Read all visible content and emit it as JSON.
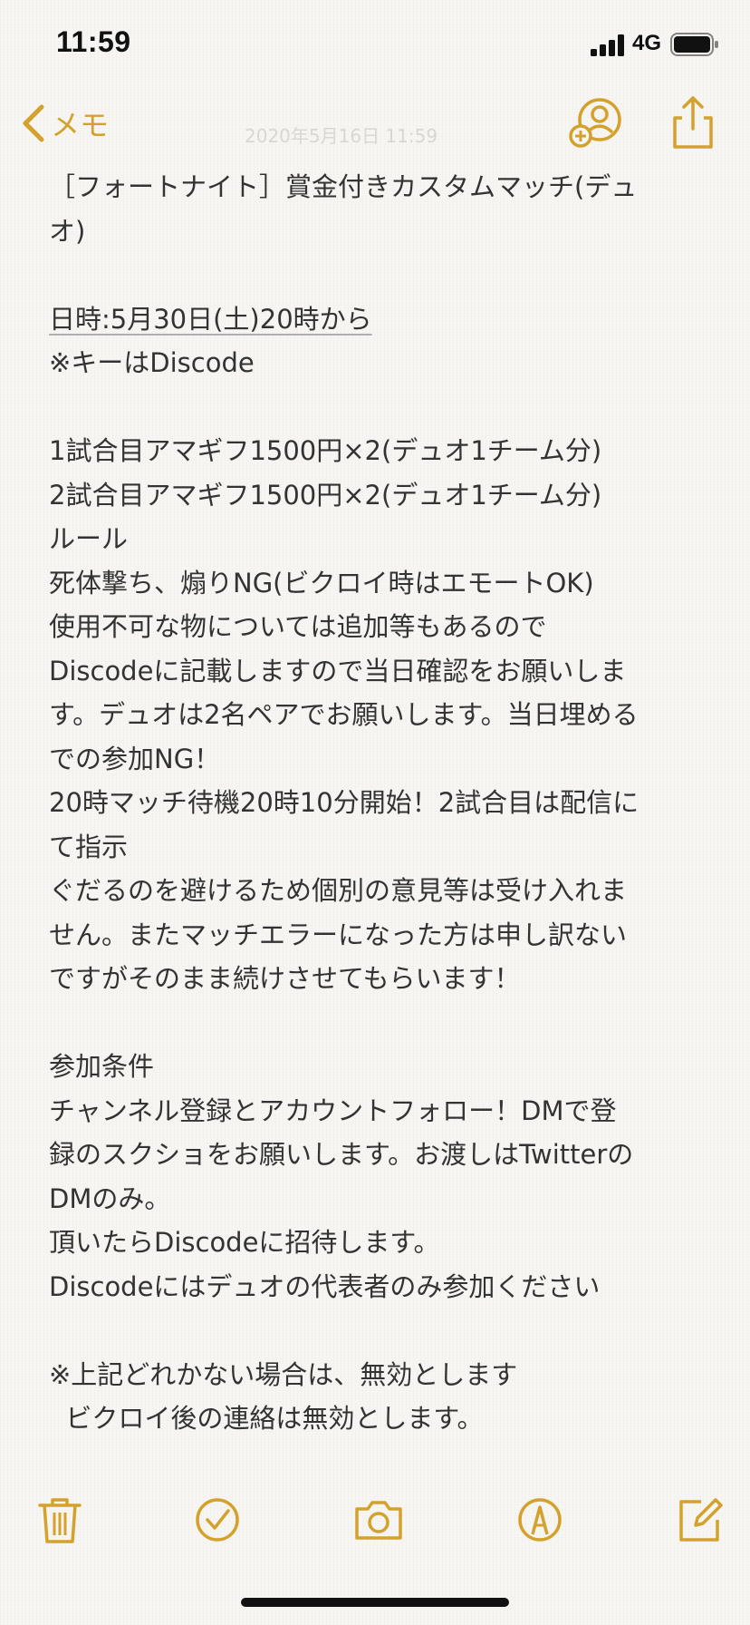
{
  "status_bar": {
    "time": "11:59",
    "network": "4G"
  },
  "nav": {
    "back_label": "メモ",
    "date_watermark": "2020年5月16日 11:59"
  },
  "colors": {
    "accent": "#d4a22c",
    "text": "#333333",
    "background": "#f7f6f2"
  },
  "icons": {
    "back": "chevron-left-icon",
    "collaborate": "add-person-icon",
    "share": "share-icon",
    "delete": "trash-icon",
    "checklist": "checkmark-circle-icon",
    "camera": "camera-icon",
    "markup": "pen-circle-icon",
    "compose": "compose-icon"
  },
  "note": {
    "lines": [
      "［フォートナイト］賞金付きカスタムマッチ(デュ",
      "オ)",
      "",
      "日時:5月30日(土)20時から",
      "※キーはDiscode",
      "",
      "1試合目アマギフ1500円×2(デュオ1チーム分)",
      "2試合目アマギフ1500円×2(デュオ1チーム分)",
      "ルール",
      "死体撃ち、煽りNG(ビクロイ時はエモートOK)",
      "使用不可な物については追加等もあるので",
      "Discodeに記載しますので当日確認をお願いしま",
      "す。デュオは2名ペアでお願いします。当日埋める",
      "での参加NG！",
      "20時マッチ待機20時10分開始！2試合目は配信に",
      "て指示",
      "ぐだるのを避けるため個別の意見等は受け入れま",
      "せん。またマッチエラーになった方は申し訳ない",
      "ですがそのまま続けさせてもらいます！",
      "",
      "参加条件",
      "チャンネル登録とアカウントフォロー！DMで登",
      "録のスクショをお願いします。お渡しはTwitterの",
      "DMのみ。",
      "頂いたらDiscodeに招待します。",
      "Discodeにはデュオの代表者のみ参加ください",
      "",
      "※上記どれかない場合は、無効とします",
      "  ビクロイ後の連絡は無効とします。"
    ]
  }
}
